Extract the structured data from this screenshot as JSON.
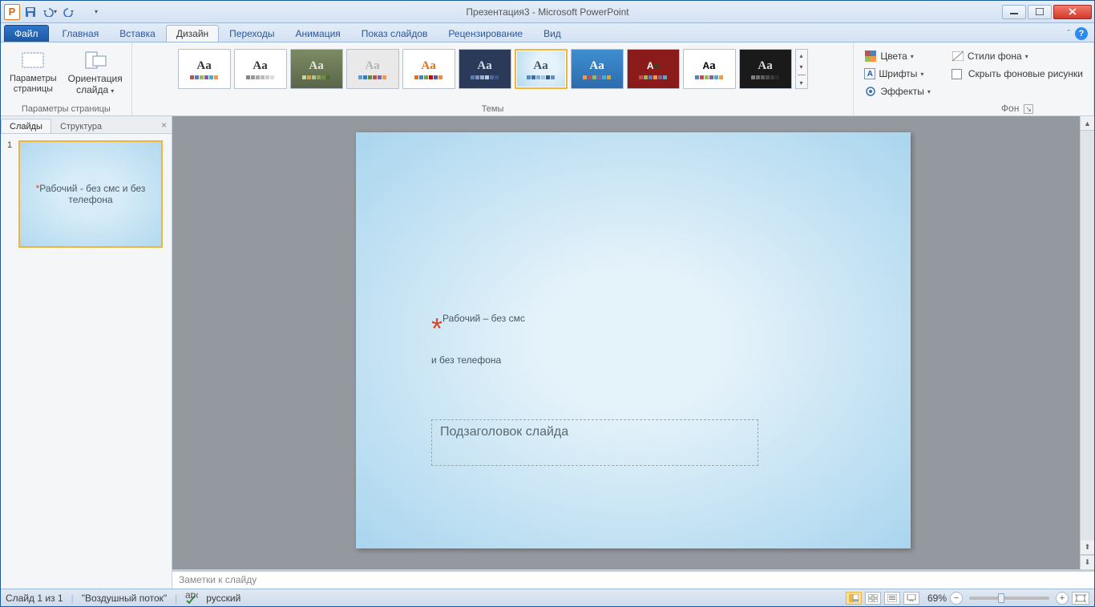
{
  "title": "Презентация3  -  Microsoft PowerPoint",
  "qat": {
    "save": "💾",
    "undo": "↶",
    "redo": "↷"
  },
  "tabs": {
    "file": "Файл",
    "items": [
      "Главная",
      "Вставка",
      "Дизайн",
      "Переходы",
      "Анимация",
      "Показ слайдов",
      "Рецензирование",
      "Вид"
    ],
    "active": "Дизайн"
  },
  "ribbon": {
    "group1": {
      "title": "Параметры страницы",
      "pageSetup": "Параметры\nстраницы",
      "orientation": "Ориентация\nслайда"
    },
    "themesTitle": "Темы",
    "colors": "Цвета",
    "fonts": "Шрифты",
    "effects": "Эффекты",
    "bgTitle": "Фон",
    "bgStyles": "Стили фона",
    "hideBg": "Скрыть фоновые рисунки"
  },
  "leftPanel": {
    "tab1": "Слайды",
    "tab2": "Структура",
    "slideNum": "1",
    "thumbTitle": "Рабочий - без смс и без телефона"
  },
  "slide": {
    "asterisk": "*",
    "titleLine1": "Рабочий – без смс",
    "titleLine2": "и без телефона",
    "subtitle": "Подзаголовок слайда"
  },
  "notesPlaceholder": "Заметки к слайду",
  "status": {
    "slideInfo": "Слайд 1 из 1",
    "theme": "\"Воздушный поток\"",
    "lang": "русский",
    "zoom": "69%"
  }
}
